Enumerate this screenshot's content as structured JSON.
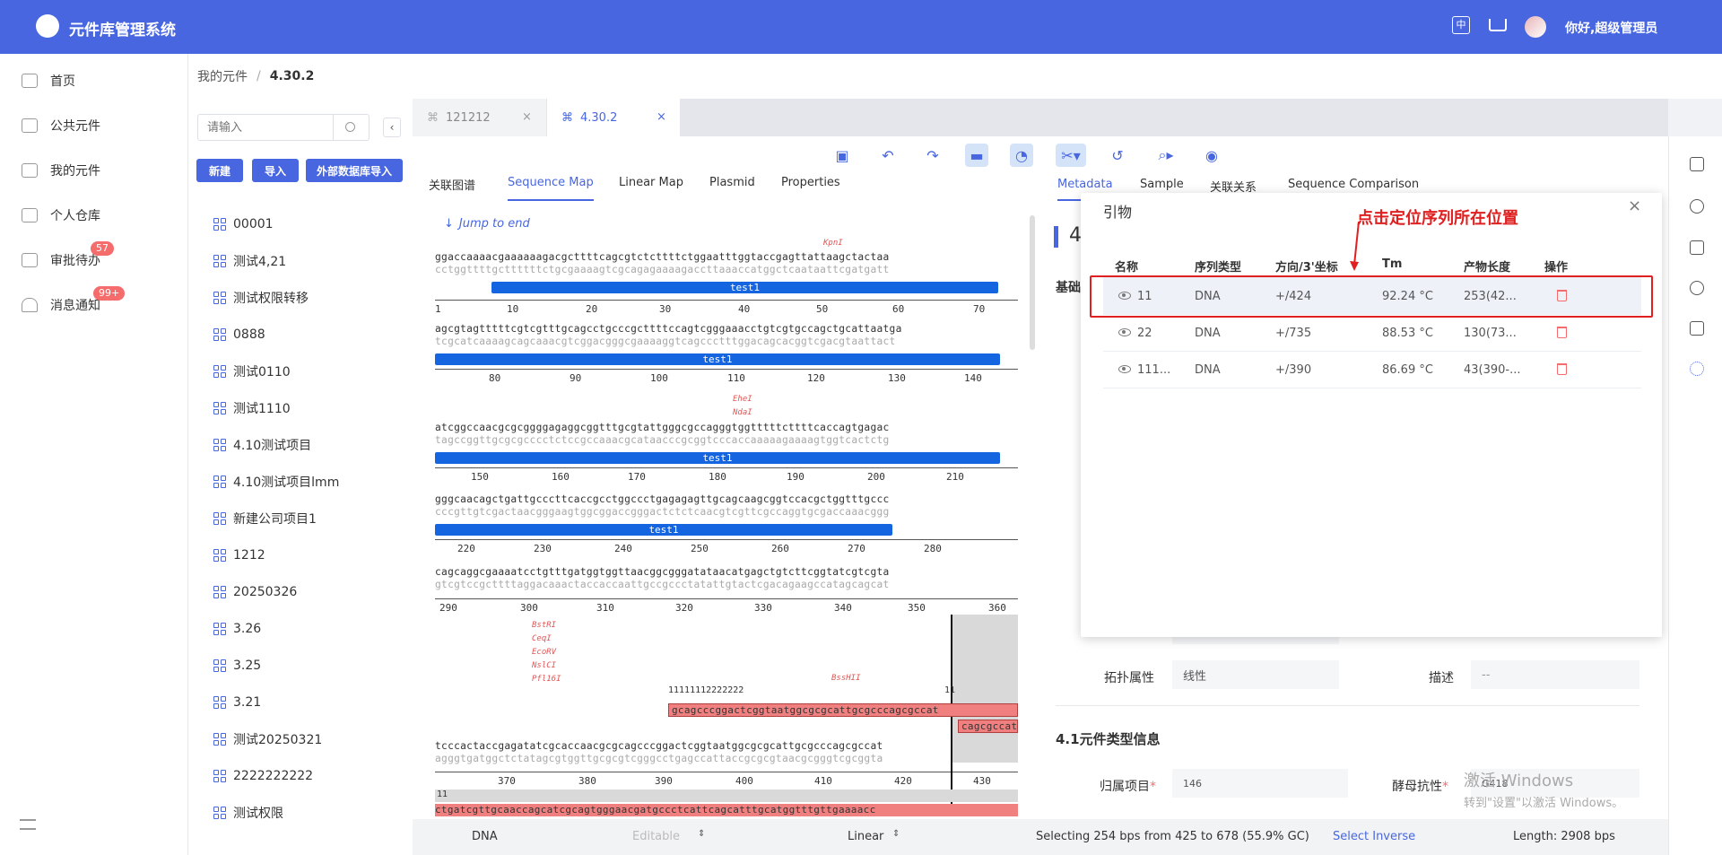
{
  "app": {
    "title": "元件库管理系统",
    "greeting": "你好,超级管理员"
  },
  "sidebar": {
    "items": [
      {
        "label": "首页",
        "icon": "home-icon"
      },
      {
        "label": "公共元件",
        "icon": "server-icon"
      },
      {
        "label": "我的元件",
        "icon": "server-icon"
      },
      {
        "label": "个人仓库",
        "icon": "warehouse-icon"
      },
      {
        "label": "审批待办",
        "icon": "checklist-icon",
        "badge": "57"
      },
      {
        "label": "消息通知",
        "icon": "bell-icon",
        "badge": "99+"
      }
    ]
  },
  "breadcrumb": {
    "parent": "我的元件",
    "sep": "/",
    "current": "4.30.2"
  },
  "tree": {
    "search_placeholder": "请输入",
    "buttons": {
      "new": "新建",
      "import": "导入",
      "external_import": "外部数据库导入"
    },
    "items": [
      "00001",
      "测试4,21",
      "测试权限转移",
      "0888",
      "测试0110",
      "测试1110",
      "4.10测试项目",
      "4.10测试项目lmm",
      "新建公司项目1",
      "1212",
      "20250326",
      "3.26",
      "3.25",
      "3.21",
      "测试20250321",
      "2222222222",
      "测试权限"
    ]
  },
  "file_tabs": [
    {
      "label": "121212",
      "active": false
    },
    {
      "label": "4.30.2",
      "active": true
    }
  ],
  "view_tabs": [
    "关联图谱",
    "Sequence Map",
    "Linear Map",
    "Plasmid",
    "Properties"
  ],
  "jump_label": "Jump to end",
  "sequence": {
    "rows": [
      {
        "top": "ggaccaaaacgaaaaaagacgcttttcagcgtctcttttctggaatttggtaccgagttattaagctactaa",
        "bottom": "cctggttttgcttttttctgcgaaaagtcgcagagaaaagaccttaaaccatggctcaataattcgatgatt",
        "feature": "test1",
        "ticks": [
          "1",
          "10",
          "20",
          "30",
          "40",
          "50",
          "60",
          "70"
        ]
      },
      {
        "top": "agcgtagtttttcgtcgtttgcagcctgcccgcttttccagtcgggaaacctgtcgtgccagctgcattaatga",
        "bottom": "tcgcatcaaaagcagcaaacgtcggacgggcgaaaaggtcagccctttggacagcacggtcgacgtaattact",
        "feature": "test1",
        "ticks": [
          "80",
          "90",
          "100",
          "110",
          "120",
          "130",
          "140"
        ]
      },
      {
        "top": "atcggccaacgcgcggggagaggcggtttgcgtattgggcgccagggtggtttttcttttcaccagtgagac",
        "bottom": "tagccggttgcgcgcccctctccgccaaacgcataacccgcggtcccaccaaaaagaaaagtggtcactctg",
        "feature": "test1",
        "ticks": [
          "150",
          "160",
          "170",
          "180",
          "190",
          "200",
          "210"
        ]
      },
      {
        "top": "gggcaacagctgattgcccttcaccgcctggccctgagagagttgcagcaagcggtccacgctggtttgccc",
        "bottom": "cccgttgtcgactaacgggaagtggcggaccgggactctctcaacgtcgttcgccaggtgcgaccaaacggg",
        "feature": "test1",
        "ticks": [
          "220",
          "230",
          "240",
          "250",
          "260",
          "270",
          "280"
        ]
      },
      {
        "top": "cagcaggcgaaaatcctgtttgatggtggttaacggcgggatataacatgagctgtcttcggtatcgtcgta",
        "bottom": "gtcgtccgcttttaggacaaactaccaccaattgccgccctatattgtactcgacagaagccatagcagcat",
        "ticks": [
          "290",
          "300",
          "310",
          "320",
          "330",
          "340",
          "350",
          "360"
        ]
      },
      {
        "top": "tcccactaccgagatatcgcaccaacgcgcagcccggactcggtaatggcgcgcattgcgcccagcgccat",
        "bottom": "agggtgatggctctatagcgtggttgcgcgtcgggcctgagccattaccgcgcgtaacgcgggtcgcggta",
        "ticks": [
          "370",
          "380",
          "390",
          "400",
          "410",
          "420",
          "430"
        ]
      }
    ],
    "enzymes": {
      "kpn": "KpnI",
      "ehe": "EheI",
      "nda": "NdaI",
      "group": [
        "BstRI",
        "CeqI",
        "EcoRV",
        "NslCI",
        "Pfl16I"
      ],
      "bss": "BssHII"
    },
    "primer_label": "11111112222222",
    "primer_top_seq": "gcagcccggactcggtaatggcgcgcattgcgcccagcgccat",
    "primer_tail_seq": "cagcgccat",
    "primer_end_label": "11",
    "last_row_label": "11",
    "last_row_seq": "ctgatcgttgcaaccagcatcgcagtgggaacgatgccctcattcagcatttgcatggtttgttgaaaacc"
  },
  "statusbar": {
    "type": "DNA",
    "editable": "Editable",
    "topology": "Linear",
    "selection": "Selecting 254 bps from 425 to 678 (55.9% GC)",
    "select_inverse": "Select Inverse",
    "length": "Length: 2908 bps"
  },
  "right_tabs": [
    "Metadata",
    "Sample",
    "关联关系",
    "Sequence Comparison"
  ],
  "right_heading_partial": "4",
  "right_basic_partial": "基础",
  "form": {
    "topology_label": "拓扑属性",
    "topology_value": "线性",
    "desc_label": "描述",
    "desc_value": "--",
    "section_title": "4.1元件类型信息",
    "project_label": "归属项目",
    "project_value": "146",
    "resist_label": "酵母抗性",
    "resist_value": "G418"
  },
  "primer_dialog": {
    "title": "引物",
    "annotation": "点击定位序列所在位置",
    "headers": [
      "名称",
      "序列类型",
      "方向/3'坐标",
      "Tm",
      "产物长度",
      "操作"
    ],
    "rows": [
      {
        "name": "11",
        "type": "DNA",
        "dir": "+/424",
        "tm": "92.24 °C",
        "len": "253(42..."
      },
      {
        "name": "22",
        "type": "DNA",
        "dir": "+/735",
        "tm": "88.53 °C",
        "len": "130(73..."
      },
      {
        "name": "111...",
        "type": "DNA",
        "dir": "+/390",
        "tm": "86.69 °C",
        "len": "43(390-..."
      }
    ]
  },
  "watermark": {
    "line1": "激活 Windows",
    "line2": "转到\"设置\"以激活 Windows。"
  },
  "colors": {
    "brand": "#4866e0",
    "feature": "#1565e0",
    "primer": "#f08080",
    "annotation": "#e02020"
  }
}
